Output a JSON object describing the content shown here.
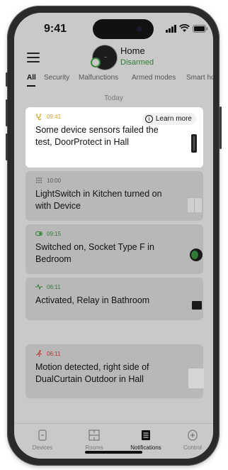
{
  "status_bar": {
    "time": "9:41"
  },
  "header": {
    "hub_name": "Home",
    "hub_status": "Disarmed"
  },
  "tabs": [
    {
      "label": "All",
      "active": true
    },
    {
      "label": "Security"
    },
    {
      "label": "Malfunctions"
    },
    {
      "label": "Armed modes"
    },
    {
      "label": "Smart home"
    }
  ],
  "date_group": "Today",
  "notifications": [
    {
      "time": "09:41",
      "icon": "malfunction-stethoscope-icon",
      "color": "#d4a017",
      "text": "Some device sensors failed the test, DoorProtect in Hall",
      "action": "Learn more",
      "device": "doorprotect"
    },
    {
      "time": "10:00",
      "icon": "keypad-icon",
      "color": "#555555",
      "text": "LightSwitch in Kitchen turned on with Device",
      "device": "lightswitch"
    },
    {
      "time": "09:15",
      "icon": "toggle-on-icon",
      "color": "#2e7d32",
      "text": "Switched on, Socket Type F in Bedroom",
      "device": "socket"
    },
    {
      "time": "06:11",
      "icon": "pulse-icon",
      "color": "#2e7d32",
      "text": "Activated, Relay in Bathroom",
      "device": "relay"
    },
    {
      "time": "06:11",
      "icon": "motion-runner-icon",
      "color": "#c62828",
      "text": "Motion detected, right side of DualCurtain Outdoor in Hall",
      "device": "dualcurtain"
    }
  ],
  "bottom_nav": [
    {
      "label": "Devices",
      "icon": "devices-icon"
    },
    {
      "label": "Rooms",
      "icon": "rooms-icon"
    },
    {
      "label": "Notifications",
      "icon": "notifications-icon",
      "active": true
    },
    {
      "label": "Control",
      "icon": "control-icon"
    }
  ]
}
